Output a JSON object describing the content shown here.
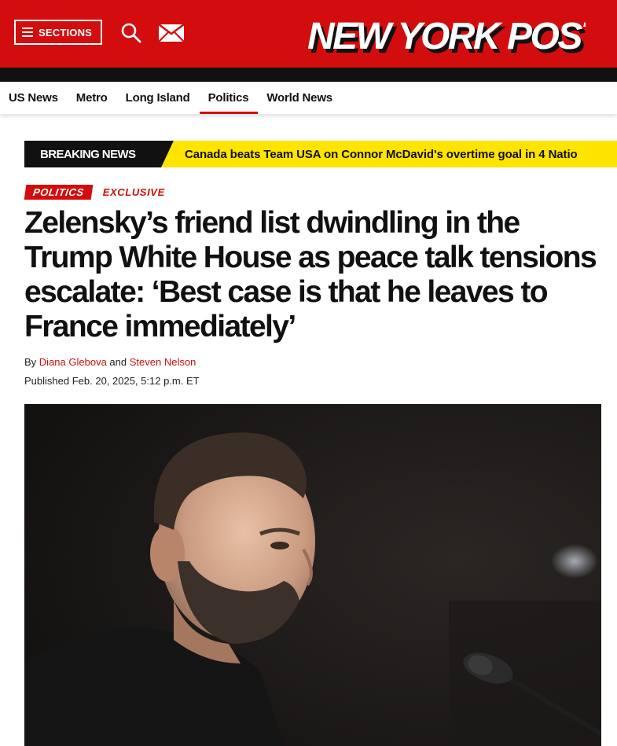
{
  "header": {
    "sections_label": "SECTIONS",
    "search_icon": "search-icon",
    "mail_icon": "mail-icon",
    "logo_text": "NEW YORK POST",
    "brand_color": "#d30d0d"
  },
  "nav": {
    "items": [
      {
        "label": "US News"
      },
      {
        "label": "Metro"
      },
      {
        "label": "Long Island"
      },
      {
        "label": "Politics",
        "active": true
      },
      {
        "label": "World News"
      }
    ]
  },
  "breaking": {
    "label": "BREAKING NEWS",
    "text": "Canada beats Team USA on Connor McDavid's overtime goal in 4 Natio",
    "accent_color": "#ffe400"
  },
  "article": {
    "category": "POLITICS",
    "badge": "EXCLUSIVE",
    "headline": "Zelensky’s friend list dwindling in the Trump White House as peace talk tensions escalate: ‘Best case is that he leaves to France immediately’",
    "byline_prefix": "By",
    "author1": "Diana Glebova",
    "byline_and": "and",
    "author2": "Steven Nelson",
    "published": "Published Feb. 20, 2025, 5:12 p.m. ET"
  }
}
